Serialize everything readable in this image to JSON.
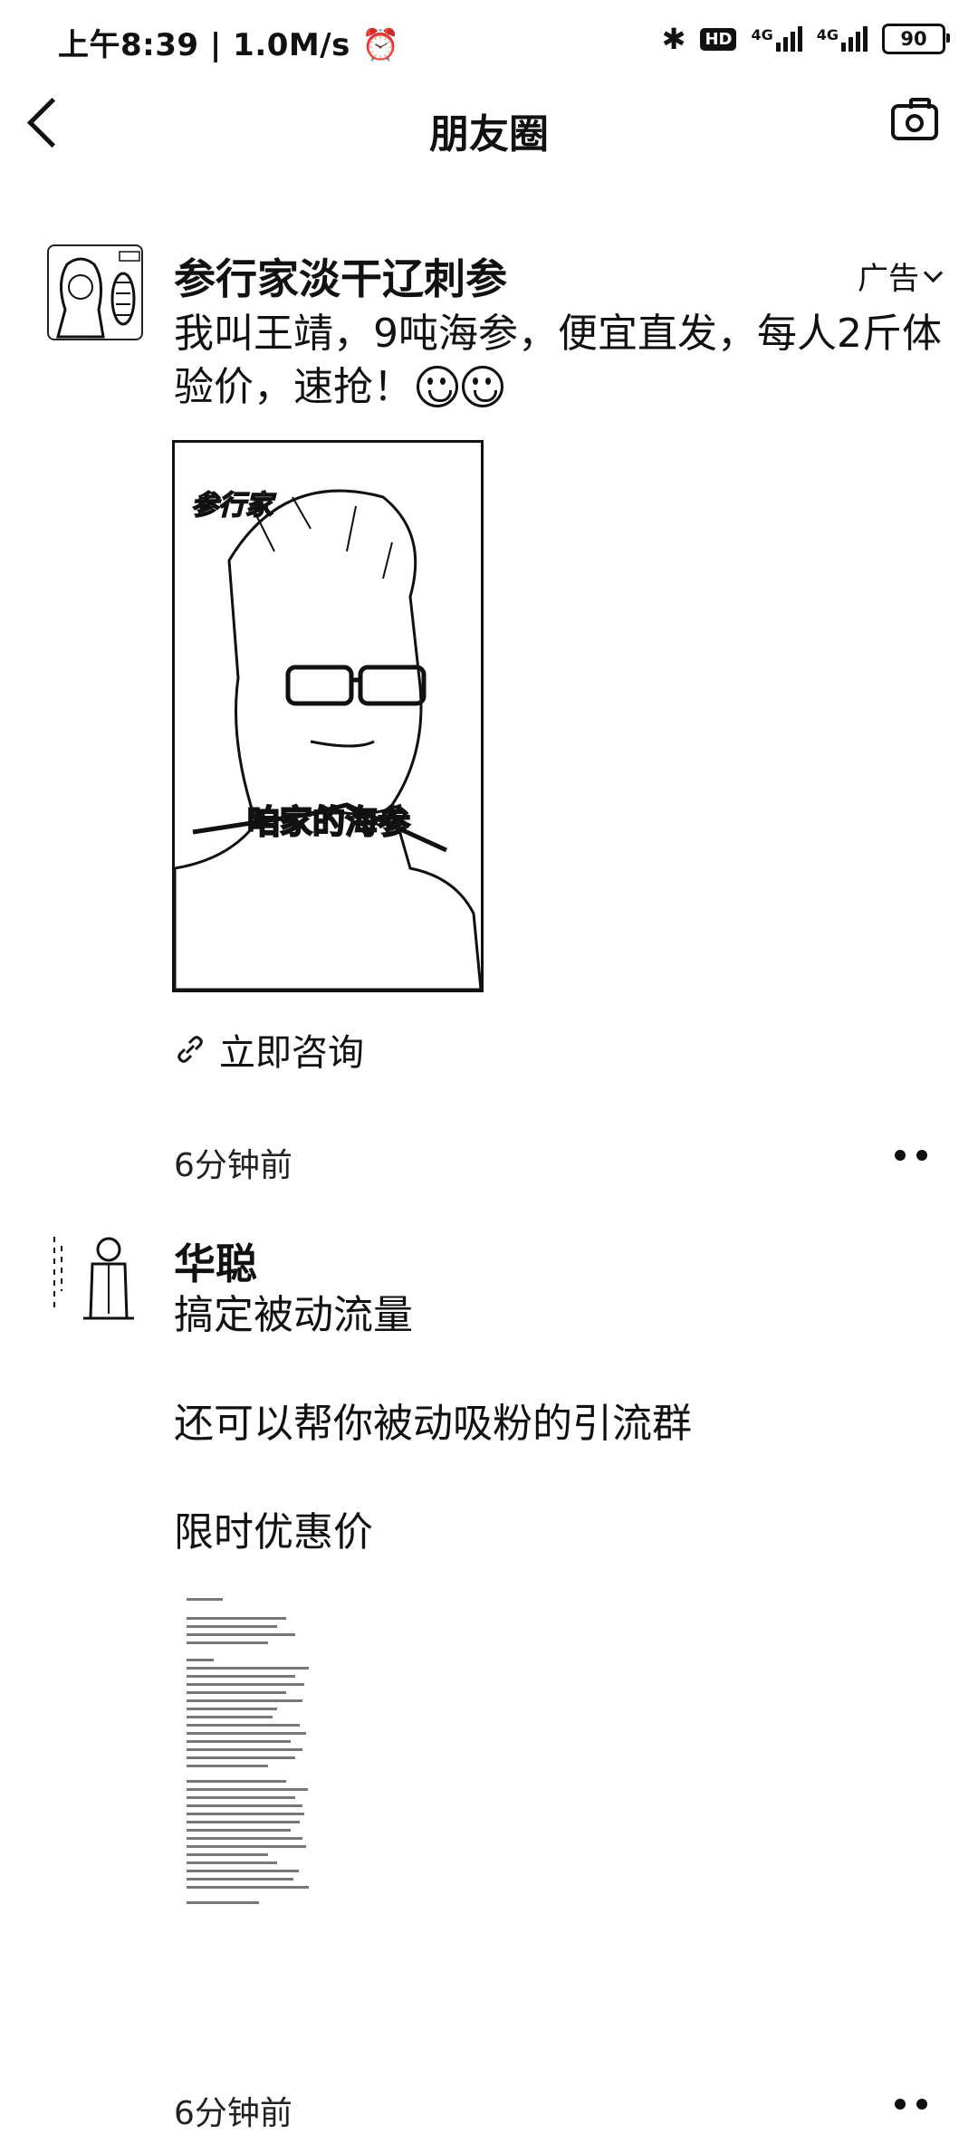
{
  "status_bar": {
    "time": "上午8:39",
    "speed": "1.0M/s",
    "hd": "HD",
    "net1": "4G",
    "net2": "4G",
    "battery": "90"
  },
  "header": {
    "title": "朋友圈"
  },
  "posts": [
    {
      "author": "参行家淡干辽刺参",
      "ad_label": "广告",
      "text": "我叫王靖，9吨海参，便宜直发，每人2斤体验价，速抢！",
      "video_watermark": "参行家",
      "video_caption": "咱家的海参",
      "link_label": "立即咨询",
      "time": "6分钟前"
    },
    {
      "author": "华聪",
      "lines": [
        "搞定被动流量",
        "还可以帮你被动吸粉的引流群",
        "限时优惠价"
      ],
      "time": "6分钟前"
    }
  ],
  "icons": [
    "back-chevron-icon",
    "camera-icon",
    "link-icon",
    "more-icon"
  ]
}
